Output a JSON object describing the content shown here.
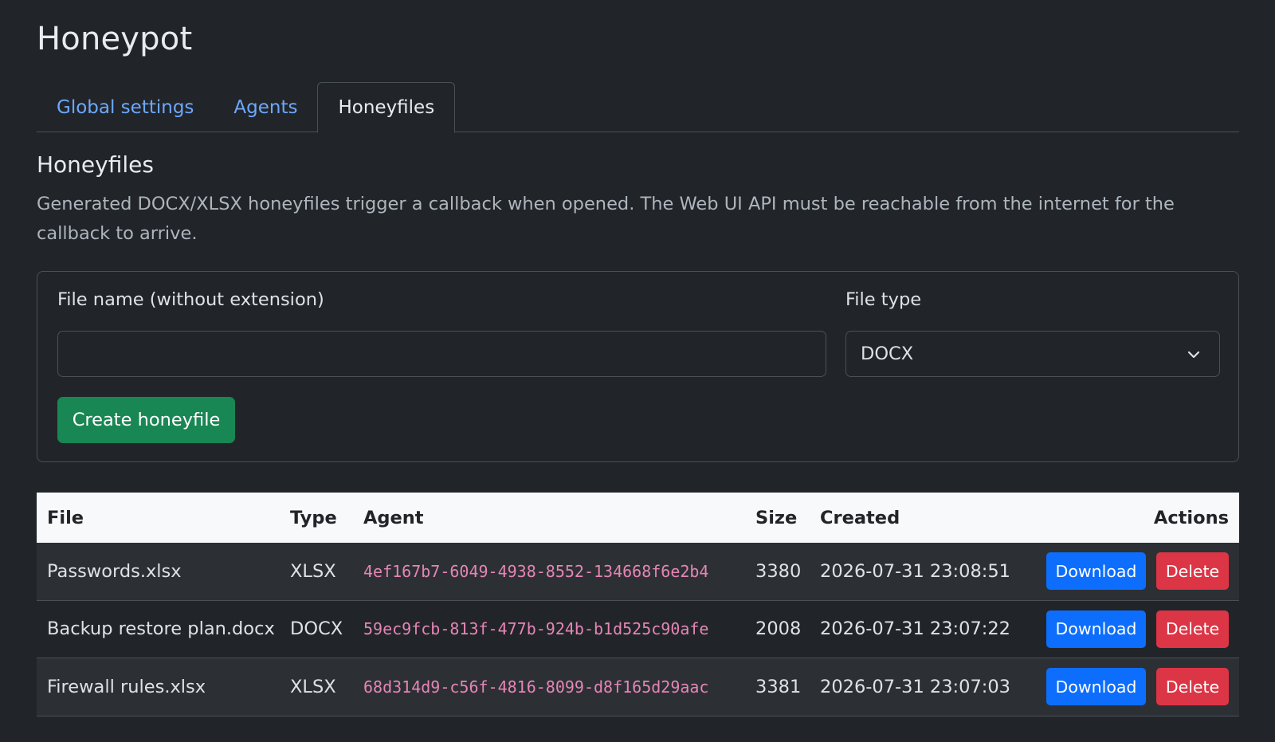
{
  "page": {
    "title": "Honeypot"
  },
  "tabs": [
    {
      "label": "Global settings",
      "active": false
    },
    {
      "label": "Agents",
      "active": false
    },
    {
      "label": "Honeyfiles",
      "active": true
    }
  ],
  "section": {
    "title": "Honeyfiles",
    "description": "Generated DOCX/XLSX honeyfiles trigger a callback when opened. The Web UI API must be reachable from the internet for the callback to arrive."
  },
  "form": {
    "file_name_label": "File name (without extension)",
    "file_name_value": "",
    "file_name_placeholder": "",
    "file_type_label": "File type",
    "file_type_selected": "DOCX",
    "create_label": "Create honeyfile"
  },
  "table": {
    "headers": {
      "file": "File",
      "type": "Type",
      "agent": "Agent",
      "size": "Size",
      "created": "Created",
      "actions": "Actions"
    },
    "rows": [
      {
        "file": "Passwords.xlsx",
        "type": "XLSX",
        "agent": "4ef167b7-6049-4938-8552-134668f6e2b4",
        "size": "3380",
        "created": "2026-07-31 23:08:51",
        "download_label": "Download",
        "delete_label": "Delete"
      },
      {
        "file": "Backup restore plan.docx",
        "type": "DOCX",
        "agent": "59ec9fcb-813f-477b-924b-b1d525c90afe",
        "size": "2008",
        "created": "2026-07-31 23:07:22",
        "download_label": "Download",
        "delete_label": "Delete"
      },
      {
        "file": "Firewall rules.xlsx",
        "type": "XLSX",
        "agent": "68d314d9-c56f-4816-8099-d8f165d29aac",
        "size": "3381",
        "created": "2026-07-31 23:07:03",
        "download_label": "Download",
        "delete_label": "Delete"
      }
    ]
  },
  "colors": {
    "background": "#212529",
    "link": "#6ea8fe",
    "success": "#198754",
    "primary": "#0d6efd",
    "danger": "#dc3545",
    "code": "#e685b5"
  },
  "icons": {
    "select_arrow": "chevron-down-icon"
  }
}
